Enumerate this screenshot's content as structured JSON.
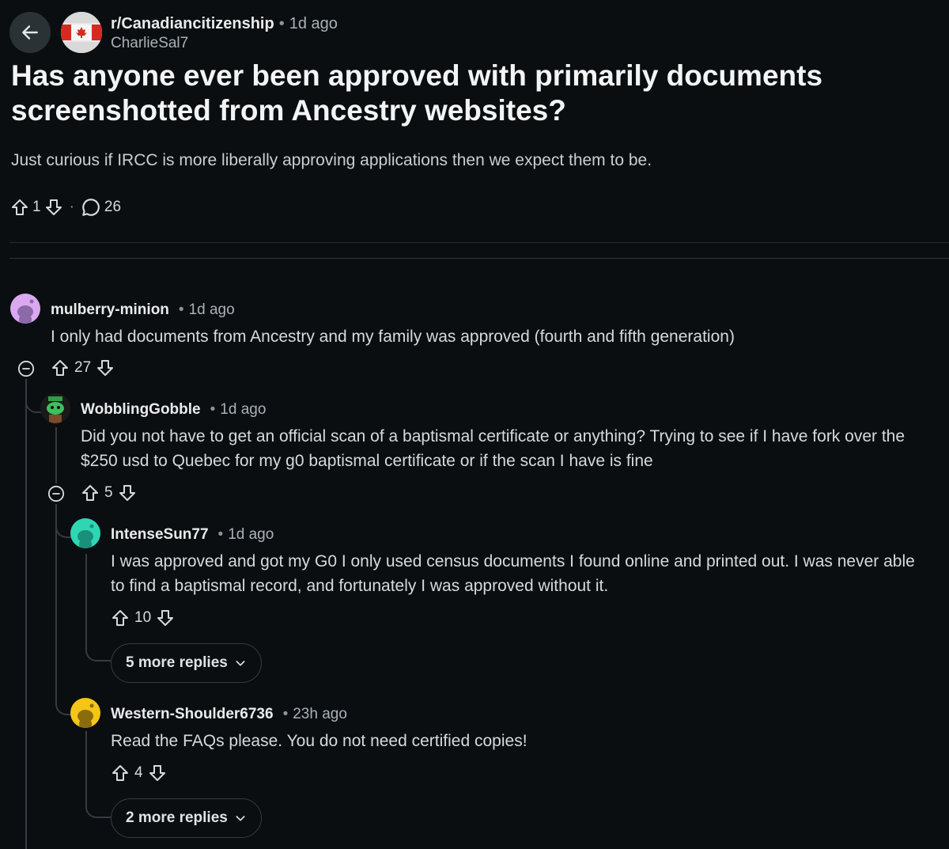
{
  "post": {
    "subreddit": "r/Canadiancitizenship",
    "time": "1d ago",
    "author": "CharlieSal7",
    "title": "Has anyone ever been approved with primarily documents screenshotted from Ancestry websites?",
    "body": "Just curious if IRCC is more liberally approving applications then we expect them to be.",
    "score": "1",
    "comment_count": "26"
  },
  "comments": [
    {
      "user": "mulberry-minion",
      "time": "1d ago",
      "text": "I only had documents from Ancestry and my family was approved (fourth and fifth generation)",
      "score": "27",
      "avatar_color": "#d9a8f0"
    },
    {
      "user": "WobblingGobble",
      "time": "1d ago",
      "text": "Did you not have to get an official scan of a baptismal certificate or anything? Trying to see if I have fork over the $250 usd to Quebec for my g0 baptismal certificate or if the scan I have is fine",
      "score": "5",
      "avatar_color": "#2e9e4a"
    },
    {
      "user": "IntenseSun77",
      "time": "1d ago",
      "text": "I was approved and got my G0 I only used census documents I found online and printed out. I was never able to find a baptismal record, and fortunately I was approved without it.",
      "score": "10",
      "more_replies": "5 more replies",
      "avatar_color": "#2fd6b4"
    },
    {
      "user": "Western-Shoulder6736",
      "time": "23h ago",
      "text": "Read the FAQs please. You do not need certified copies!",
      "score": "4",
      "more_replies": "2 more replies",
      "avatar_color": "#f5c518"
    }
  ],
  "icons": {
    "back": "arrow-left-icon",
    "upvote": "arrow-up-outline-icon",
    "downvote": "arrow-down-outline-icon",
    "comments": "speech-bubble-icon",
    "collapse": "minus-circle-icon",
    "expand": "chevron-down-icon"
  }
}
